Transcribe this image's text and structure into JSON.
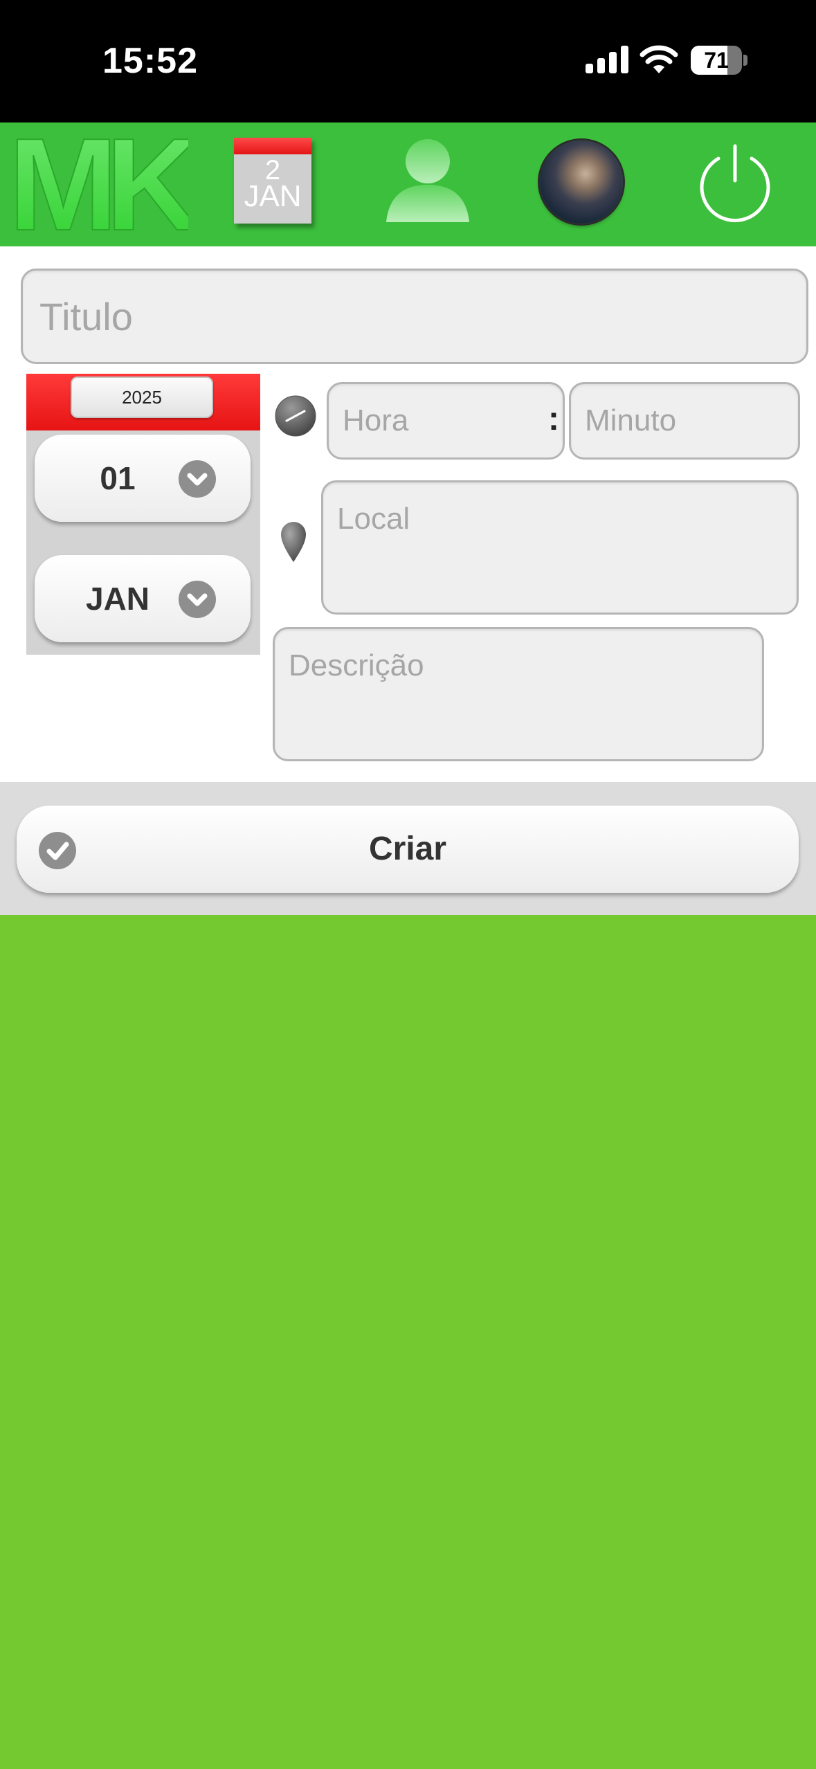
{
  "status_bar": {
    "time": "15:52",
    "battery": "71"
  },
  "header": {
    "logo_text": "MK",
    "calendar": {
      "day": "2",
      "month": "JAN"
    }
  },
  "form": {
    "titulo_placeholder": "Titulo",
    "year": "2025",
    "day_value": "01",
    "month_value": "JAN",
    "hora_placeholder": "Hora",
    "time_separator": ":",
    "minuto_placeholder": "Minuto",
    "local_placeholder": "Local",
    "descricao_placeholder": "Descrição"
  },
  "actions": {
    "criar_label": "Criar"
  },
  "colors": {
    "header_green": "#3cbf3c",
    "background_green": "#73c92f",
    "accent_red": "#e61414"
  }
}
